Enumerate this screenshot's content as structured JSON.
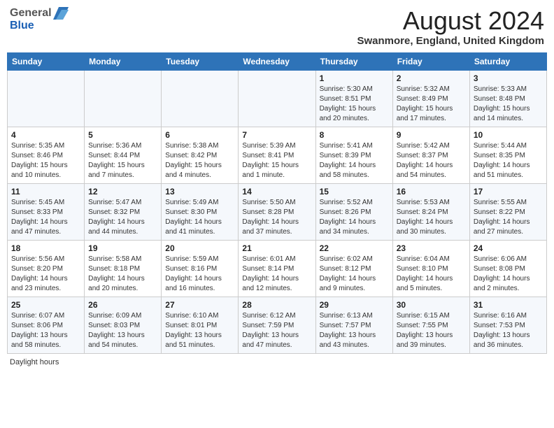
{
  "header": {
    "logo_general": "General",
    "logo_blue": "Blue",
    "month_year": "August 2024",
    "location": "Swanmore, England, United Kingdom"
  },
  "footer": {
    "daylight_hours": "Daylight hours"
  },
  "weekdays": [
    "Sunday",
    "Monday",
    "Tuesday",
    "Wednesday",
    "Thursday",
    "Friday",
    "Saturday"
  ],
  "weeks": [
    [
      {
        "day": "",
        "info": ""
      },
      {
        "day": "",
        "info": ""
      },
      {
        "day": "",
        "info": ""
      },
      {
        "day": "",
        "info": ""
      },
      {
        "day": "1",
        "info": "Sunrise: 5:30 AM\nSunset: 8:51 PM\nDaylight: 15 hours\nand 20 minutes."
      },
      {
        "day": "2",
        "info": "Sunrise: 5:32 AM\nSunset: 8:49 PM\nDaylight: 15 hours\nand 17 minutes."
      },
      {
        "day": "3",
        "info": "Sunrise: 5:33 AM\nSunset: 8:48 PM\nDaylight: 15 hours\nand 14 minutes."
      }
    ],
    [
      {
        "day": "4",
        "info": "Sunrise: 5:35 AM\nSunset: 8:46 PM\nDaylight: 15 hours\nand 10 minutes."
      },
      {
        "day": "5",
        "info": "Sunrise: 5:36 AM\nSunset: 8:44 PM\nDaylight: 15 hours\nand 7 minutes."
      },
      {
        "day": "6",
        "info": "Sunrise: 5:38 AM\nSunset: 8:42 PM\nDaylight: 15 hours\nand 4 minutes."
      },
      {
        "day": "7",
        "info": "Sunrise: 5:39 AM\nSunset: 8:41 PM\nDaylight: 15 hours\nand 1 minute."
      },
      {
        "day": "8",
        "info": "Sunrise: 5:41 AM\nSunset: 8:39 PM\nDaylight: 14 hours\nand 58 minutes."
      },
      {
        "day": "9",
        "info": "Sunrise: 5:42 AM\nSunset: 8:37 PM\nDaylight: 14 hours\nand 54 minutes."
      },
      {
        "day": "10",
        "info": "Sunrise: 5:44 AM\nSunset: 8:35 PM\nDaylight: 14 hours\nand 51 minutes."
      }
    ],
    [
      {
        "day": "11",
        "info": "Sunrise: 5:45 AM\nSunset: 8:33 PM\nDaylight: 14 hours\nand 47 minutes."
      },
      {
        "day": "12",
        "info": "Sunrise: 5:47 AM\nSunset: 8:32 PM\nDaylight: 14 hours\nand 44 minutes."
      },
      {
        "day": "13",
        "info": "Sunrise: 5:49 AM\nSunset: 8:30 PM\nDaylight: 14 hours\nand 41 minutes."
      },
      {
        "day": "14",
        "info": "Sunrise: 5:50 AM\nSunset: 8:28 PM\nDaylight: 14 hours\nand 37 minutes."
      },
      {
        "day": "15",
        "info": "Sunrise: 5:52 AM\nSunset: 8:26 PM\nDaylight: 14 hours\nand 34 minutes."
      },
      {
        "day": "16",
        "info": "Sunrise: 5:53 AM\nSunset: 8:24 PM\nDaylight: 14 hours\nand 30 minutes."
      },
      {
        "day": "17",
        "info": "Sunrise: 5:55 AM\nSunset: 8:22 PM\nDaylight: 14 hours\nand 27 minutes."
      }
    ],
    [
      {
        "day": "18",
        "info": "Sunrise: 5:56 AM\nSunset: 8:20 PM\nDaylight: 14 hours\nand 23 minutes."
      },
      {
        "day": "19",
        "info": "Sunrise: 5:58 AM\nSunset: 8:18 PM\nDaylight: 14 hours\nand 20 minutes."
      },
      {
        "day": "20",
        "info": "Sunrise: 5:59 AM\nSunset: 8:16 PM\nDaylight: 14 hours\nand 16 minutes."
      },
      {
        "day": "21",
        "info": "Sunrise: 6:01 AM\nSunset: 8:14 PM\nDaylight: 14 hours\nand 12 minutes."
      },
      {
        "day": "22",
        "info": "Sunrise: 6:02 AM\nSunset: 8:12 PM\nDaylight: 14 hours\nand 9 minutes."
      },
      {
        "day": "23",
        "info": "Sunrise: 6:04 AM\nSunset: 8:10 PM\nDaylight: 14 hours\nand 5 minutes."
      },
      {
        "day": "24",
        "info": "Sunrise: 6:06 AM\nSunset: 8:08 PM\nDaylight: 14 hours\nand 2 minutes."
      }
    ],
    [
      {
        "day": "25",
        "info": "Sunrise: 6:07 AM\nSunset: 8:06 PM\nDaylight: 13 hours\nand 58 minutes."
      },
      {
        "day": "26",
        "info": "Sunrise: 6:09 AM\nSunset: 8:03 PM\nDaylight: 13 hours\nand 54 minutes."
      },
      {
        "day": "27",
        "info": "Sunrise: 6:10 AM\nSunset: 8:01 PM\nDaylight: 13 hours\nand 51 minutes."
      },
      {
        "day": "28",
        "info": "Sunrise: 6:12 AM\nSunset: 7:59 PM\nDaylight: 13 hours\nand 47 minutes."
      },
      {
        "day": "29",
        "info": "Sunrise: 6:13 AM\nSunset: 7:57 PM\nDaylight: 13 hours\nand 43 minutes."
      },
      {
        "day": "30",
        "info": "Sunrise: 6:15 AM\nSunset: 7:55 PM\nDaylight: 13 hours\nand 39 minutes."
      },
      {
        "day": "31",
        "info": "Sunrise: 6:16 AM\nSunset: 7:53 PM\nDaylight: 13 hours\nand 36 minutes."
      }
    ]
  ]
}
